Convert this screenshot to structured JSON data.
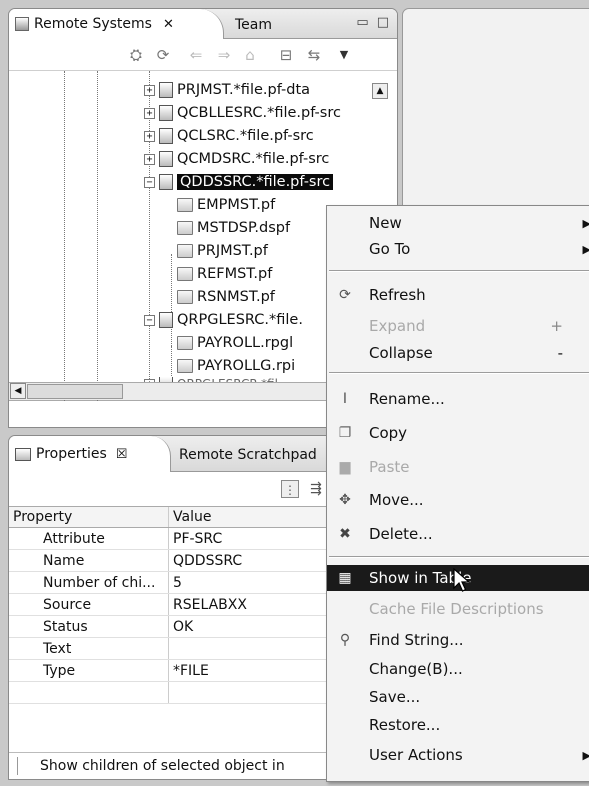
{
  "remote_systems": {
    "tab_label": "Remote Systems",
    "tab_close": "✕",
    "team_tab": "Team",
    "minimize": "▭",
    "maximize": "□",
    "tree": [
      {
        "label": "PRJMST.*file.pf-dta",
        "expand": "+"
      },
      {
        "label": "QCBLLESRC.*file.pf-src",
        "expand": "+"
      },
      {
        "label": "QCLSRC.*file.pf-src",
        "expand": "+"
      },
      {
        "label": "QCMDSRC.*file.pf-src",
        "expand": "+"
      },
      {
        "label": "QDDSSRC.*file.pf-src",
        "expand": "−",
        "selected": true
      },
      {
        "label": "EMPMST.pf"
      },
      {
        "label": "MSTDSP.dspf"
      },
      {
        "label": "PRJMST.pf"
      },
      {
        "label": "REFMST.pf"
      },
      {
        "label": "RSNMST.pf"
      },
      {
        "label": "QRPGLESRC.*file.",
        "expand": "−"
      },
      {
        "label": "PAYROLL.rpgl"
      },
      {
        "label": "PAYROLLG.rpi"
      },
      {
        "label": "QRPGLESRCR.*fil",
        "expand": "+"
      }
    ]
  },
  "properties": {
    "tab_label": "Properties",
    "tab_close": "☒",
    "scratchpad_tab": "Remote Scratchpad",
    "col_property": "Property",
    "col_value": "Value",
    "rows": [
      {
        "property": "Attribute",
        "value": "PF-SRC"
      },
      {
        "property": "Name",
        "value": "QDDSSRC"
      },
      {
        "property": "Number of chi...",
        "value": "5"
      },
      {
        "property": "Source",
        "value": "RSELABXX"
      },
      {
        "property": "Status",
        "value": "OK"
      },
      {
        "property": "Text",
        "value": ""
      },
      {
        "property": "Type",
        "value": "*FILE"
      }
    ],
    "status": "Show children of selected object in"
  },
  "menu": {
    "items": [
      {
        "label": "New",
        "submenu": true,
        "icon": ""
      },
      {
        "label": "Go To",
        "submenu": true,
        "icon": ""
      },
      {
        "label": "Refresh",
        "icon": "refresh-icon"
      },
      {
        "label": "Expand",
        "accel": "+",
        "disabled": true
      },
      {
        "label": "Collapse",
        "accel": "-"
      },
      {
        "label": "Rename...",
        "icon": "rename-icon"
      },
      {
        "label": "Copy",
        "icon": "copy-icon"
      },
      {
        "label": "Paste",
        "icon": "paste-icon",
        "disabled": true
      },
      {
        "label": "Move...",
        "icon": "move-icon"
      },
      {
        "label": "Delete...",
        "icon": "delete-icon"
      },
      {
        "label": "Show in Table",
        "icon": "table-icon",
        "highlighted": true
      },
      {
        "label": "Cache File Descriptions",
        "disabled": true
      },
      {
        "label": "Find String...",
        "icon": "find-string-icon"
      },
      {
        "label": "Change(B)..."
      },
      {
        "label": "Save..."
      },
      {
        "label": "Restore..."
      },
      {
        "label": "User Actions",
        "submenu": true
      }
    ],
    "submenu_arrow": "▶"
  }
}
